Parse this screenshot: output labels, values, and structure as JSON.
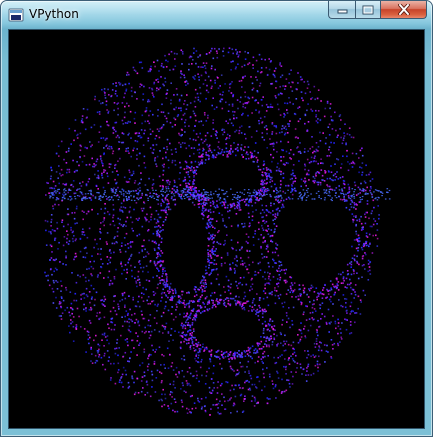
{
  "window": {
    "title": "VPython",
    "icons": {
      "app": "vpython-app-icon",
      "minimize": "minimize-icon",
      "maximize": "maximize-icon",
      "close": "close-icon"
    }
  },
  "scene": {
    "background": "#000000",
    "point_colors": [
      "#2323ff",
      "#3b3bff",
      "#5a2cff",
      "#8a1cff",
      "#c21cf2",
      "#e81be0",
      "#5050ff"
    ]
  }
}
